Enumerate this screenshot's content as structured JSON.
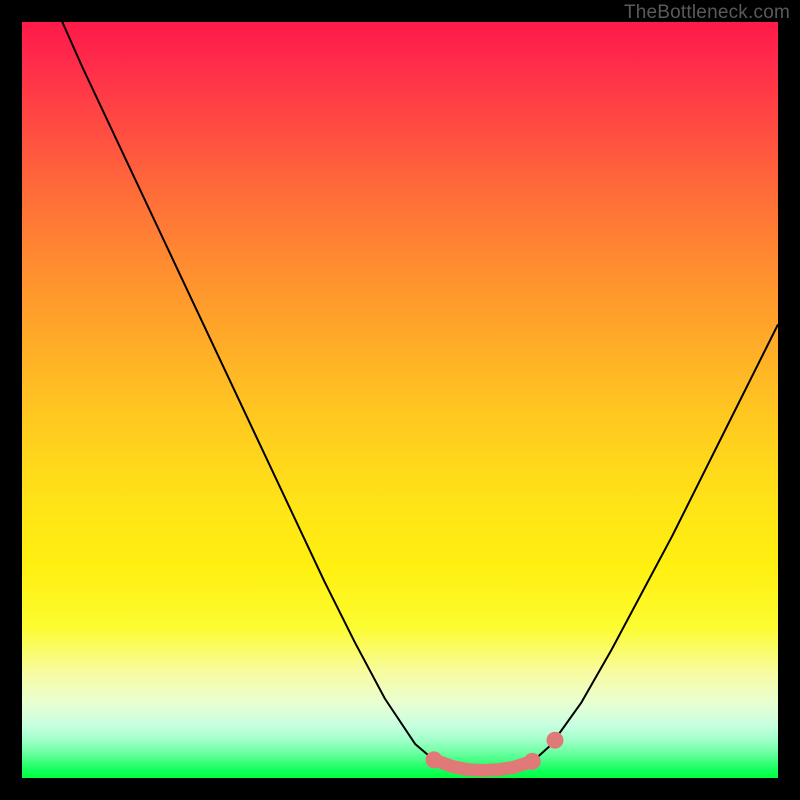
{
  "watermark": "TheBottleneck.com",
  "chart_data": {
    "type": "line",
    "title": "",
    "xlabel": "",
    "ylabel": "",
    "xlim": [
      0,
      100
    ],
    "ylim": [
      0,
      100
    ],
    "series": [
      {
        "name": "bottleneck-curve",
        "x": [
          0,
          4,
          8,
          12,
          16,
          20,
          24,
          28,
          32,
          36,
          40,
          44,
          48,
          52,
          54,
          56,
          58,
          60,
          62,
          64,
          66,
          68,
          70,
          74,
          78,
          82,
          86,
          90,
          94,
          98,
          100
        ],
        "y": [
          112,
          103,
          94,
          85.5,
          77,
          68.5,
          60,
          51.5,
          43,
          34.5,
          26,
          18,
          10.5,
          4.5,
          2.8,
          1.8,
          1.2,
          1.0,
          1.0,
          1.2,
          1.6,
          2.6,
          4.4,
          10,
          17,
          24.5,
          32,
          40,
          48,
          56,
          60
        ]
      }
    ],
    "markers": [
      {
        "name": "flat-region-left-end",
        "x": 54.5,
        "y": 2.4
      },
      {
        "name": "flat-region-point",
        "x": 57,
        "y": 1.5
      },
      {
        "name": "flat-region-point",
        "x": 59,
        "y": 1.1
      },
      {
        "name": "flat-region-point",
        "x": 61,
        "y": 1.0
      },
      {
        "name": "flat-region-point",
        "x": 63,
        "y": 1.1
      },
      {
        "name": "flat-region-point",
        "x": 65,
        "y": 1.4
      },
      {
        "name": "flat-region-right-end",
        "x": 67.5,
        "y": 2.2
      },
      {
        "name": "detached-marker",
        "x": 70.5,
        "y": 5.0
      }
    ],
    "background_gradient": {
      "top": "#ff1a4a",
      "upper_mid": "#ff8c30",
      "mid": "#ffe018",
      "lower_mid": "#f8fca0",
      "bottom": "#00ff40"
    }
  }
}
